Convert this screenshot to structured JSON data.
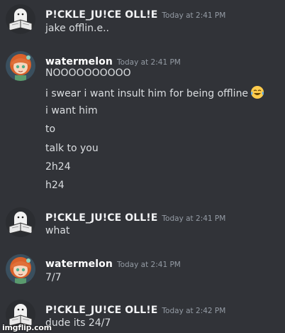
{
  "colors": {
    "background": "#313338",
    "username_pickle": "#f2f3f5",
    "username_watermelon": "#ffffff",
    "timestamp": "#949ba4",
    "message_text": "#dbdee1"
  },
  "messages": [
    {
      "author": "P!CKLE_JU!CE OLL!E",
      "timestamp": "Today at 2:41 PM",
      "avatar_icon": "ghost-reading-avatar",
      "lines": [
        "jake offlin.e.."
      ]
    },
    {
      "author": "watermelon",
      "timestamp": "Today at 2:41 PM",
      "avatar_icon": "anime-girl-avatar",
      "lines": [
        "NOOOOOOOOOO",
        "i swear i want insult him for being offline",
        "i want him",
        "to",
        "talk to you",
        "2h24",
        "h24"
      ],
      "emoji": "face-with-tears-of-joy"
    },
    {
      "author": "P!CKLE_JU!CE OLL!E",
      "timestamp": "Today at 2:41 PM",
      "avatar_icon": "ghost-reading-avatar",
      "lines": [
        "what"
      ]
    },
    {
      "author": "watermelon",
      "timestamp": "Today at 2:41 PM",
      "avatar_icon": "anime-girl-avatar",
      "lines": [
        "7/7"
      ]
    },
    {
      "author": "P!CKLE_JU!CE OLL!E",
      "timestamp": "Today at 2:42 PM",
      "avatar_icon": "ghost-reading-avatar",
      "lines": [
        "dude its 24/7"
      ]
    }
  ],
  "watermark": "imgflip.com"
}
